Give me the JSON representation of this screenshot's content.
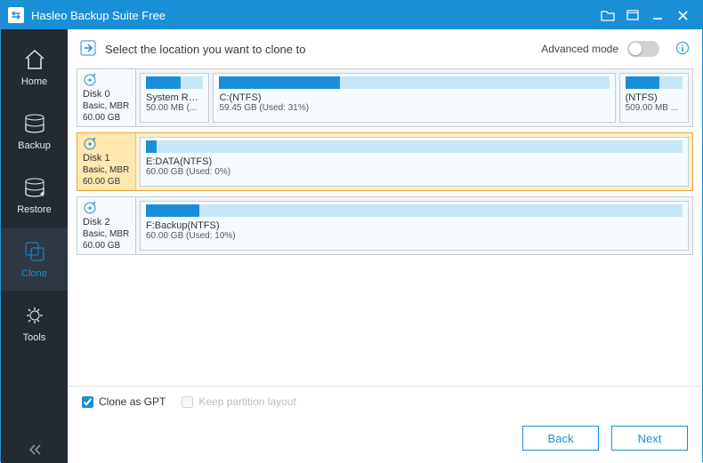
{
  "titlebar": {
    "app_name": "Hasleo Backup Suite Free"
  },
  "sidebar": {
    "items": [
      {
        "label": "Home"
      },
      {
        "label": "Backup"
      },
      {
        "label": "Restore"
      },
      {
        "label": "Clone"
      },
      {
        "label": "Tools"
      }
    ],
    "active_index": 3
  },
  "instruction": {
    "text": "Select the location you want to clone to",
    "advanced_label": "Advanced mode",
    "advanced_on": false
  },
  "disks": [
    {
      "name": "Disk 0",
      "scheme": "Basic, MBR",
      "capacity": "60.00 GB",
      "selected": false,
      "partitions": [
        {
          "label": "System Reser",
          "size": "50.00 MB (...",
          "used_pct": 60,
          "flex_weight": 10
        },
        {
          "label": "C:(NTFS)",
          "size": "59.45 GB (Used: 31%)",
          "used_pct": 31,
          "flex_weight": 68
        },
        {
          "label": "(NTFS)",
          "size": "509.00 MB ...",
          "used_pct": 60,
          "flex_weight": 10
        }
      ]
    },
    {
      "name": "Disk 1",
      "scheme": "Basic, MBR",
      "capacity": "60.00 GB",
      "selected": true,
      "partitions": [
        {
          "label": "E:DATA(NTFS)",
          "size": "60.00 GB (Used: 0%)",
          "used_pct": 2,
          "flex_weight": 100
        }
      ]
    },
    {
      "name": "Disk 2",
      "scheme": "Basic, MBR",
      "capacity": "60.00 GB",
      "selected": false,
      "partitions": [
        {
          "label": "F:Backup(NTFS)",
          "size": "60.00 GB (Used: 10%)",
          "used_pct": 10,
          "flex_weight": 100
        }
      ]
    }
  ],
  "options": {
    "clone_as_gpt": {
      "label": "Clone as GPT",
      "checked": true,
      "enabled": true
    },
    "keep_layout": {
      "label": "Keep partition layout",
      "checked": false,
      "enabled": false
    }
  },
  "footer": {
    "back": "Back",
    "next": "Next"
  }
}
